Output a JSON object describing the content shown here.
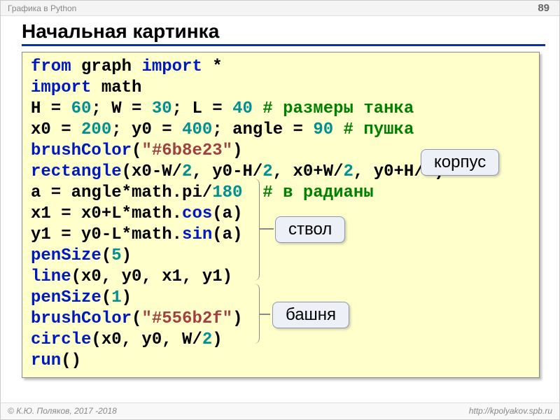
{
  "header": {
    "topic": "Графика в Python",
    "page": "89"
  },
  "title": "Начальная картинка",
  "code": {
    "l1": {
      "kw1": "from",
      "m1": "graph",
      "kw2": "import",
      "star": "*"
    },
    "l2": {
      "kw": "import",
      "m": "math"
    },
    "l3": {
      "a": "H = ",
      "n1": "60",
      "b": "; W = ",
      "n2": "30",
      "c": "; L = ",
      "n3": "40",
      "cmt": " # размеры танка"
    },
    "l4": {
      "a": "x0 = ",
      "n1": "200",
      "b": "; y0 = ",
      "n2": "400",
      "c": "; angle = ",
      "n3": "90",
      "cmt": " # пушка"
    },
    "l5": {
      "f": "brushColor",
      "p": "(",
      "s": "\"#6b8e23\"",
      "q": ")"
    },
    "l6": {
      "f": "rectangle",
      "a": "(x0-W/",
      "n1": "2",
      "b": ", y0-H/",
      "n2": "2",
      "c": ", x0+W/",
      "n3": "2",
      "d": ", y0+H/",
      "n4": "2",
      "e": ")"
    },
    "l7": {
      "a": "a = angle*math.pi/",
      "n": "180",
      "sp": "  ",
      "cmt": "# в радианы"
    },
    "l8": {
      "a": "x1 = x0+L*math.",
      "f": "cos",
      "b": "(a)"
    },
    "l9": {
      "a": "y1 = y0-L*math.",
      "f": "sin",
      "b": "(a)"
    },
    "l10": {
      "f": "penSize",
      "a": "(",
      "n": "5",
      "b": ")"
    },
    "l11": {
      "f": "line",
      "a": "(x0, y0, x1, y1)"
    },
    "l12": {
      "f": "penSize",
      "a": "(",
      "n": "1",
      "b": ")"
    },
    "l13": {
      "f": "brushColor",
      "p": "(",
      "s": "\"#556b2f\"",
      "q": ")"
    },
    "l14": {
      "f": "circle",
      "a": "(x0, y0, W/",
      "n": "2",
      "b": ")"
    },
    "l15": {
      "f": "run",
      "a": "()"
    }
  },
  "callouts": {
    "body": "корпус",
    "barrel": "ствол",
    "turret": "башня"
  },
  "footer": {
    "left": "К.Ю. Поляков, 2017 -2018",
    "right": "http://kpolyakov.spb.ru"
  }
}
